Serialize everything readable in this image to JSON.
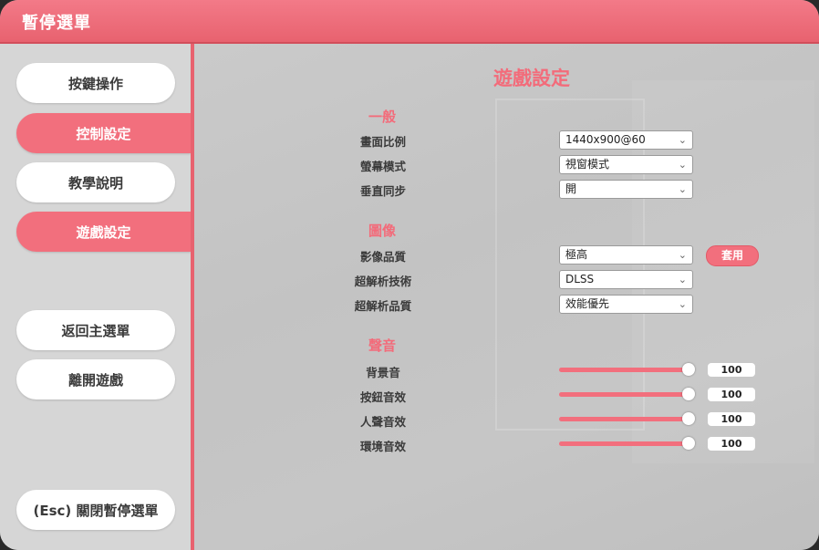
{
  "window": {
    "title": "暫停選單"
  },
  "sidebar": {
    "items": [
      {
        "label": "按鍵操作",
        "active": false
      },
      {
        "label": "控制設定",
        "active": true
      },
      {
        "label": "教學說明",
        "active": false
      },
      {
        "label": "遊戲設定",
        "active": true
      }
    ],
    "return_label": "返回主選單",
    "exit_label": "離開遊戲",
    "close_label": "(Esc) 關閉暫停選單"
  },
  "settings": {
    "title": "遊戲設定",
    "general": {
      "header": "一般",
      "rows": [
        {
          "label": "畫面比例",
          "value": "1440x900@60"
        },
        {
          "label": "螢幕模式",
          "value": "視窗模式"
        },
        {
          "label": "垂直同步",
          "value": "開"
        }
      ]
    },
    "graphics": {
      "header": "圖像",
      "rows": [
        {
          "label": "影像品質",
          "value": "極高"
        },
        {
          "label": "超解析技術",
          "value": "DLSS"
        },
        {
          "label": "超解析品質",
          "value": "效能優先"
        }
      ],
      "apply_label": "套用"
    },
    "audio": {
      "header": "聲音",
      "rows": [
        {
          "label": "背景音",
          "value": 100,
          "display": "100"
        },
        {
          "label": "按鈕音效",
          "value": 100,
          "display": "100"
        },
        {
          "label": "人聲音效",
          "value": 100,
          "display": "100"
        },
        {
          "label": "環境音效",
          "value": 100,
          "display": "100"
        }
      ],
      "max": 100
    }
  },
  "icons": {
    "dropdown": "chevron-down-icon",
    "chevron_glyph": "⌄"
  },
  "colors": {
    "accent": "#f26f7d",
    "title_bar": "#e8626f",
    "background": "#c7c7c7"
  }
}
